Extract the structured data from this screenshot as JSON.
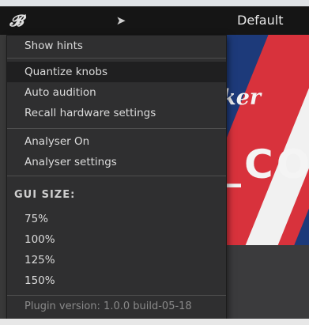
{
  "topbar": {
    "preset_name": "Default",
    "logo_icon": "italic-b-logo-icon",
    "back_icon": "back-arrow-icon"
  },
  "art": {
    "brand_word": "ker",
    "big_letters": "_CO"
  },
  "menu": {
    "items": [
      {
        "label": "Show hints"
      },
      {
        "label": "Quantize knobs"
      },
      {
        "label": "Auto audition"
      },
      {
        "label": "Recall hardware settings"
      },
      {
        "label": "Analyser On"
      },
      {
        "label": "Analyser settings"
      }
    ],
    "gui_size_header": "GUI SIZE:",
    "sizes": [
      "75%",
      "100%",
      "125%",
      "150%"
    ],
    "plugin_version": "Plugin version: 1.0.0 build-05-18"
  },
  "colors": {
    "menu_bg": "#2f2f30",
    "topbar_bg": "#151515",
    "stripe_red": "#d8323c",
    "art_blue": "#1d3a7a"
  }
}
